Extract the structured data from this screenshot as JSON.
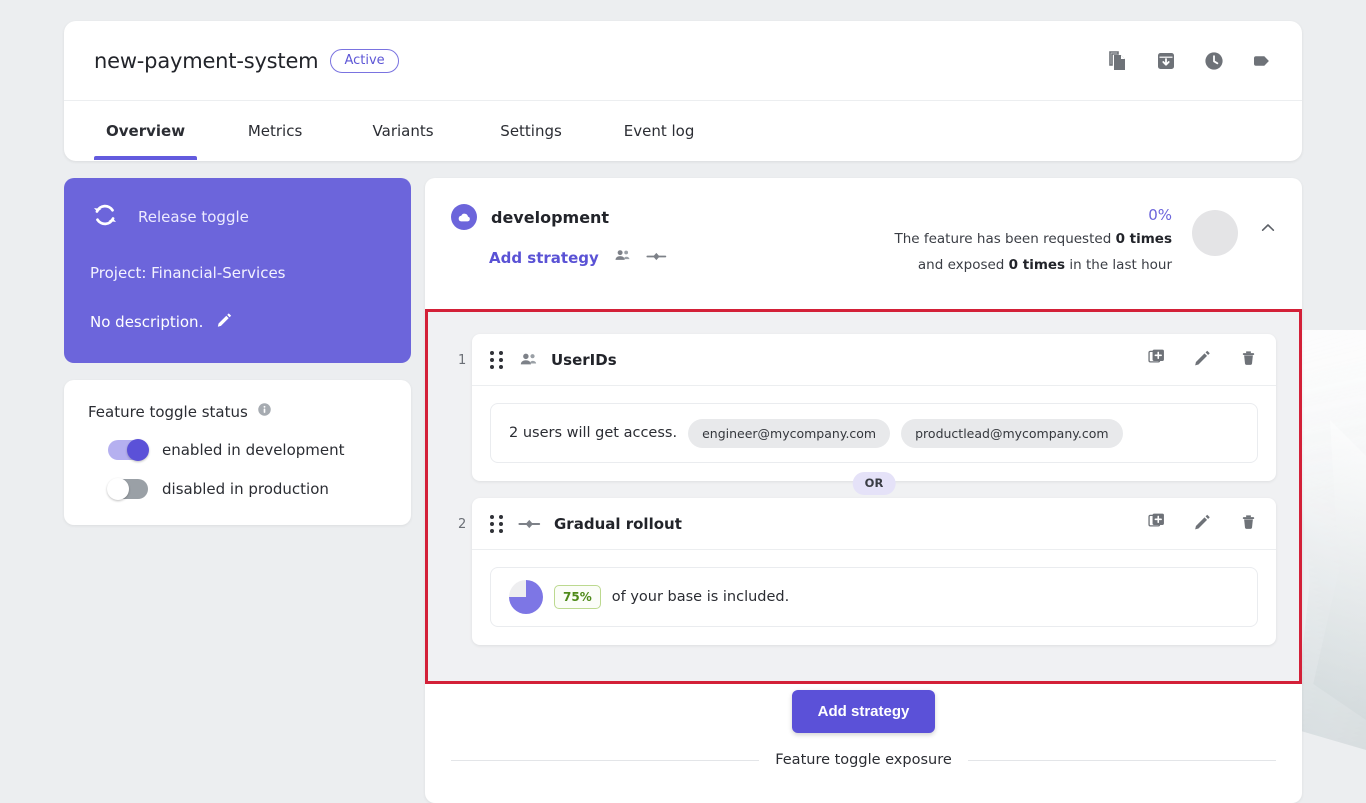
{
  "header": {
    "feature_name": "new-payment-system",
    "status_label": "Active",
    "actions": [
      {
        "name": "copy-icon",
        "title": "Copy"
      },
      {
        "name": "archive-icon",
        "title": "Archive"
      },
      {
        "name": "history-icon",
        "title": "History"
      },
      {
        "name": "tag-icon",
        "title": "Tags"
      }
    ],
    "tabs": [
      {
        "label": "Overview",
        "active": true
      },
      {
        "label": "Metrics",
        "active": false
      },
      {
        "label": "Variants",
        "active": false
      },
      {
        "label": "Settings",
        "active": false
      },
      {
        "label": "Event log",
        "active": false
      }
    ]
  },
  "release_card": {
    "toggle_type": "Release toggle",
    "project": "Project: Financial-Services",
    "description": "No description."
  },
  "toggle_status": {
    "title": "Feature toggle status",
    "items": [
      {
        "label": "enabled in development",
        "state": "on"
      },
      {
        "label": "disabled in production",
        "state": "off"
      }
    ]
  },
  "environment": {
    "name": "development",
    "add_strategy_link": "Add strategy",
    "percentage": "0%",
    "stats_line1_pre": "The feature has been requested ",
    "stats_line1_bold": "0 times",
    "stats_line2_pre": "and exposed ",
    "stats_line2_bold": "0 times",
    "stats_line2_post": " in the last hour"
  },
  "strategies": [
    {
      "index": "1",
      "type_icon": "users-icon",
      "title": "UserIDs",
      "detail_text": "2 users will get access.",
      "chips": [
        "engineer@mycompany.com",
        "productlead@mycompany.com"
      ]
    },
    {
      "index": "2",
      "type_icon": "rollout-icon",
      "title": "Gradual rollout",
      "percent_badge": "75%",
      "detail_text": "of your base is included."
    }
  ],
  "or_separator": "OR",
  "row_actions": [
    {
      "name": "duplicate-strategy-icon"
    },
    {
      "name": "edit-strategy-icon"
    },
    {
      "name": "delete-strategy-icon"
    }
  ],
  "footer": {
    "add_strategy_button": "Add strategy",
    "exposure_label": "Feature toggle exposure"
  },
  "colors": {
    "accent_purple": "#6c65db",
    "button_purple": "#5b51d8",
    "highlight_red": "#d32038",
    "green": "#4f8a1a",
    "page_bg": "#eceef0"
  },
  "chart_data": {
    "type": "pie",
    "title": "Gradual rollout base included",
    "categories": [
      "included",
      "not included"
    ],
    "values": [
      75,
      25
    ]
  }
}
